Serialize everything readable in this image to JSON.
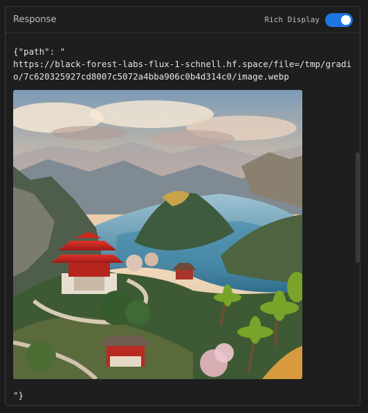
{
  "header": {
    "title": "Response",
    "toggle_label": "Rich Display",
    "toggle_on": true
  },
  "content": {
    "open_text": "{\"path\": \"",
    "url": "https://black-forest-labs-flux-1-schnell.hf.space/file=/tmp/gradio/7c620325927cd8007c5072a4bba906c0b4d314c0/image.webp",
    "close_text": "\"}"
  },
  "colors": {
    "accent": "#1d76e2",
    "background": "#1e1e1e"
  }
}
